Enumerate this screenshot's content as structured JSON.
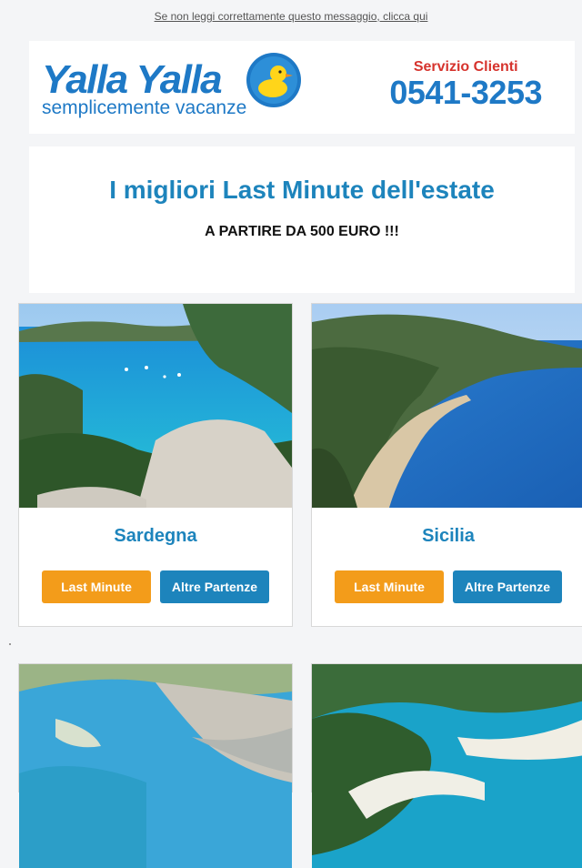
{
  "topline": {
    "text": "Se non leggi correttamente questo messaggio, clicca qui"
  },
  "header": {
    "logo_name": "Yalla Yalla",
    "logo_tagline": "semplicemente vacanze",
    "contact_label": "Servizio Clienti",
    "contact_phone": "0541-3253"
  },
  "hero": {
    "title": "I migliori Last Minute dell'estate",
    "subtitle": "A PARTIRE DA 500 EURO !!!"
  },
  "destinations": [
    {
      "name": "Sardegna",
      "btn_primary": "Last Minute",
      "btn_secondary": "Altre Partenze"
    },
    {
      "name": "Sicilia",
      "btn_primary": "Last Minute",
      "btn_secondary": "Altre Partenze"
    }
  ],
  "colors": {
    "brand_blue": "#1d84bc",
    "accent_orange": "#f39c1a",
    "phone_red": "#d6332d"
  }
}
